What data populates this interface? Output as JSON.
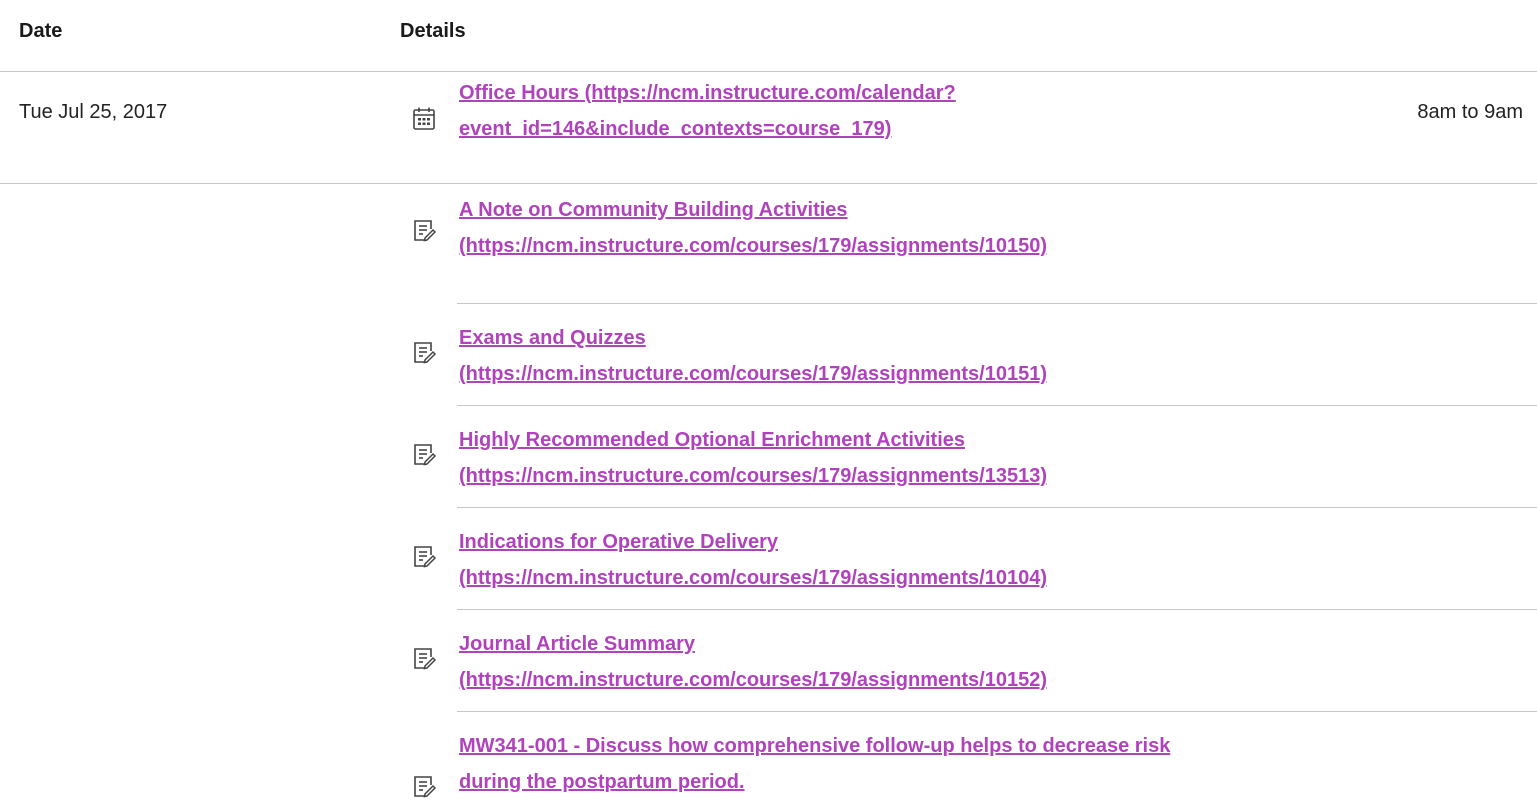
{
  "table": {
    "headers": {
      "date": "Date",
      "details": "Details"
    }
  },
  "event": {
    "date": "Tue Jul 25, 2017",
    "title": "Office Hours",
    "url_line1": "(https://ncm.instructure.com/calendar?",
    "url_line2": "event_id=146&include_contexts=course_179)",
    "time": "8am to 9am"
  },
  "assignments": [
    {
      "title": "A Note on Community Building Activities",
      "url": "(https://ncm.instructure.com/courses/179/assignments/10150)"
    },
    {
      "title": "Exams and Quizzes",
      "url": "(https://ncm.instructure.com/courses/179/assignments/10151)"
    },
    {
      "title": "Highly Recommended Optional Enrichment Activities",
      "url": "(https://ncm.instructure.com/courses/179/assignments/13513)"
    },
    {
      "title": "Indications for Operative Delivery",
      "url": "(https://ncm.instructure.com/courses/179/assignments/10104)"
    },
    {
      "title": "Journal Article Summary",
      "url": "(https://ncm.instructure.com/courses/179/assignments/10152)"
    },
    {
      "title_line1": "MW341-001 - Discuss how comprehensive follow-up helps to decrease risk",
      "title_line2": "during the postpartum period."
    }
  ],
  "icons": {
    "event": "calendar-icon",
    "assignment": "assignment-icon"
  },
  "colors": {
    "link": "#b043bc",
    "divider": "#c7c7c7"
  }
}
